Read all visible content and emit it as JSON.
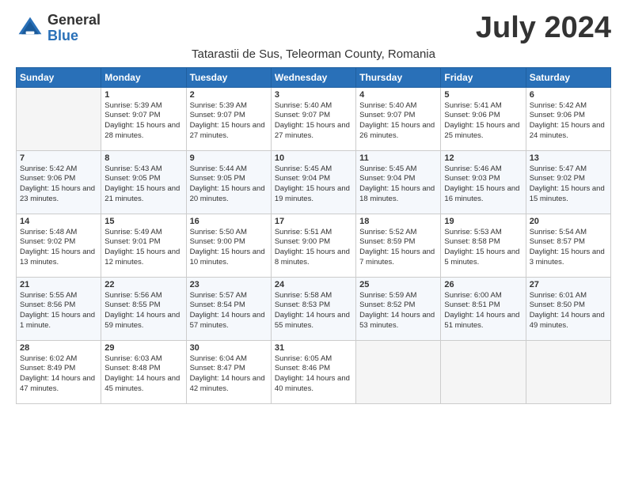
{
  "header": {
    "logo_general": "General",
    "logo_blue": "Blue",
    "month_title": "July 2024",
    "subtitle": "Tatarastii de Sus, Teleorman County, Romania"
  },
  "weekdays": [
    "Sunday",
    "Monday",
    "Tuesday",
    "Wednesday",
    "Thursday",
    "Friday",
    "Saturday"
  ],
  "weeks": [
    [
      {
        "day": "",
        "info": ""
      },
      {
        "day": "1",
        "info": "Sunrise: 5:39 AM\nSunset: 9:07 PM\nDaylight: 15 hours\nand 28 minutes."
      },
      {
        "day": "2",
        "info": "Sunrise: 5:39 AM\nSunset: 9:07 PM\nDaylight: 15 hours\nand 27 minutes."
      },
      {
        "day": "3",
        "info": "Sunrise: 5:40 AM\nSunset: 9:07 PM\nDaylight: 15 hours\nand 27 minutes."
      },
      {
        "day": "4",
        "info": "Sunrise: 5:40 AM\nSunset: 9:07 PM\nDaylight: 15 hours\nand 26 minutes."
      },
      {
        "day": "5",
        "info": "Sunrise: 5:41 AM\nSunset: 9:06 PM\nDaylight: 15 hours\nand 25 minutes."
      },
      {
        "day": "6",
        "info": "Sunrise: 5:42 AM\nSunset: 9:06 PM\nDaylight: 15 hours\nand 24 minutes."
      }
    ],
    [
      {
        "day": "7",
        "info": "Sunrise: 5:42 AM\nSunset: 9:06 PM\nDaylight: 15 hours\nand 23 minutes."
      },
      {
        "day": "8",
        "info": "Sunrise: 5:43 AM\nSunset: 9:05 PM\nDaylight: 15 hours\nand 21 minutes."
      },
      {
        "day": "9",
        "info": "Sunrise: 5:44 AM\nSunset: 9:05 PM\nDaylight: 15 hours\nand 20 minutes."
      },
      {
        "day": "10",
        "info": "Sunrise: 5:45 AM\nSunset: 9:04 PM\nDaylight: 15 hours\nand 19 minutes."
      },
      {
        "day": "11",
        "info": "Sunrise: 5:45 AM\nSunset: 9:04 PM\nDaylight: 15 hours\nand 18 minutes."
      },
      {
        "day": "12",
        "info": "Sunrise: 5:46 AM\nSunset: 9:03 PM\nDaylight: 15 hours\nand 16 minutes."
      },
      {
        "day": "13",
        "info": "Sunrise: 5:47 AM\nSunset: 9:02 PM\nDaylight: 15 hours\nand 15 minutes."
      }
    ],
    [
      {
        "day": "14",
        "info": "Sunrise: 5:48 AM\nSunset: 9:02 PM\nDaylight: 15 hours\nand 13 minutes."
      },
      {
        "day": "15",
        "info": "Sunrise: 5:49 AM\nSunset: 9:01 PM\nDaylight: 15 hours\nand 12 minutes."
      },
      {
        "day": "16",
        "info": "Sunrise: 5:50 AM\nSunset: 9:00 PM\nDaylight: 15 hours\nand 10 minutes."
      },
      {
        "day": "17",
        "info": "Sunrise: 5:51 AM\nSunset: 9:00 PM\nDaylight: 15 hours\nand 8 minutes."
      },
      {
        "day": "18",
        "info": "Sunrise: 5:52 AM\nSunset: 8:59 PM\nDaylight: 15 hours\nand 7 minutes."
      },
      {
        "day": "19",
        "info": "Sunrise: 5:53 AM\nSunset: 8:58 PM\nDaylight: 15 hours\nand 5 minutes."
      },
      {
        "day": "20",
        "info": "Sunrise: 5:54 AM\nSunset: 8:57 PM\nDaylight: 15 hours\nand 3 minutes."
      }
    ],
    [
      {
        "day": "21",
        "info": "Sunrise: 5:55 AM\nSunset: 8:56 PM\nDaylight: 15 hours\nand 1 minute."
      },
      {
        "day": "22",
        "info": "Sunrise: 5:56 AM\nSunset: 8:55 PM\nDaylight: 14 hours\nand 59 minutes."
      },
      {
        "day": "23",
        "info": "Sunrise: 5:57 AM\nSunset: 8:54 PM\nDaylight: 14 hours\nand 57 minutes."
      },
      {
        "day": "24",
        "info": "Sunrise: 5:58 AM\nSunset: 8:53 PM\nDaylight: 14 hours\nand 55 minutes."
      },
      {
        "day": "25",
        "info": "Sunrise: 5:59 AM\nSunset: 8:52 PM\nDaylight: 14 hours\nand 53 minutes."
      },
      {
        "day": "26",
        "info": "Sunrise: 6:00 AM\nSunset: 8:51 PM\nDaylight: 14 hours\nand 51 minutes."
      },
      {
        "day": "27",
        "info": "Sunrise: 6:01 AM\nSunset: 8:50 PM\nDaylight: 14 hours\nand 49 minutes."
      }
    ],
    [
      {
        "day": "28",
        "info": "Sunrise: 6:02 AM\nSunset: 8:49 PM\nDaylight: 14 hours\nand 47 minutes."
      },
      {
        "day": "29",
        "info": "Sunrise: 6:03 AM\nSunset: 8:48 PM\nDaylight: 14 hours\nand 45 minutes."
      },
      {
        "day": "30",
        "info": "Sunrise: 6:04 AM\nSunset: 8:47 PM\nDaylight: 14 hours\nand 42 minutes."
      },
      {
        "day": "31",
        "info": "Sunrise: 6:05 AM\nSunset: 8:46 PM\nDaylight: 14 hours\nand 40 minutes."
      },
      {
        "day": "",
        "info": ""
      },
      {
        "day": "",
        "info": ""
      },
      {
        "day": "",
        "info": ""
      }
    ]
  ]
}
